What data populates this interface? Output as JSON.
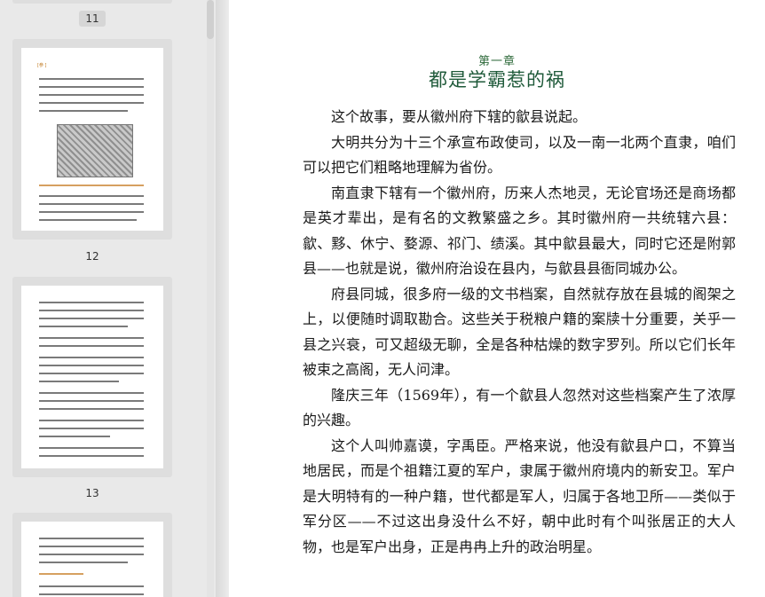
{
  "sidebar": {
    "selected_page": "11",
    "pages": [
      "12",
      "13"
    ],
    "thumb12": {
      "tag": "[参 ]"
    }
  },
  "document": {
    "chapter_label": "第一章",
    "chapter_title": "都是学霸惹的祸",
    "paragraphs": [
      "这个故事，要从徽州府下辖的歙县说起。",
      "大明共分为十三个承宣布政使司，以及一南一北两个直隶，咱们可以把它们粗略地理解为省份。",
      "南直隶下辖有一个徽州府，历来人杰地灵，无论官场还是商场都是英才辈出，是有名的文教繁盛之乡。其时徽州府一共统辖六县：歙、黟、休宁、婺源、祁门、绩溪。其中歙县最大，同时它还是附郭县——也就是说，徽州府治设在县内，与歙县县衙同城办公。",
      "府县同城，很多府一级的文书档案，自然就存放在县城的阁架之上，以便随时调取勘合。这些关于税粮户籍的案牍十分重要，关乎一县之兴衰，可又超级无聊，全是各种枯燥的数字罗列。所以它们长年被束之高阁，无人问津。",
      "隆庆三年（1569年），有一个歙县人忽然对这些档案产生了浓厚的兴趣。",
      "这个人叫帅嘉谟，字禹臣。严格来说，他没有歙县户口，不算当地居民，而是个祖籍江夏的军户，隶属于徽州府境内的新安卫。军户是大明特有的一种户籍，世代都是军人，归属于各地卫所——类似于军分区——不过这出身没什么不好，朝中此时有个叫张居正的大人物，也是军户出身，正是冉冉上升的政治明星。"
    ]
  }
}
